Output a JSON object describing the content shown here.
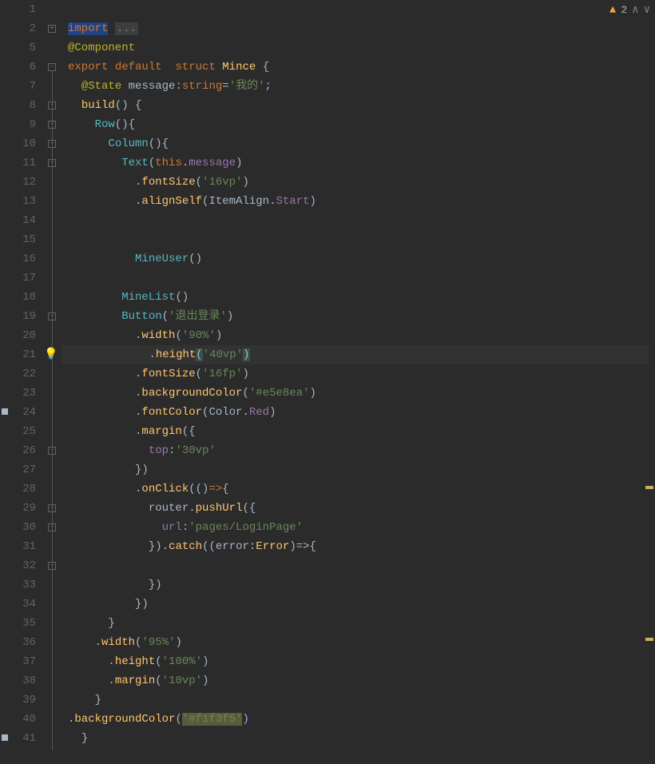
{
  "annotations": {
    "warn_count": "2"
  },
  "gutter_lines": [
    "1",
    "2",
    "5",
    "6",
    "7",
    "8",
    "9",
    "10",
    "11",
    "12",
    "13",
    "14",
    "15",
    "16",
    "17",
    "18",
    "19",
    "20",
    "21",
    "22",
    "23",
    "24",
    "25",
    "26",
    "27",
    "28",
    "29",
    "30",
    "31",
    "32",
    "33",
    "34",
    "35",
    "36",
    "37",
    "38",
    "39",
    "40",
    "41"
  ],
  "code": {
    "l1_import": "import",
    "l1_fold": "...",
    "l2_anno": "@Component",
    "l3_export": "export",
    "l3_default": "default",
    "l3_struct": "struct",
    "l3_name": "Mince",
    "l3_brace": " {",
    "l4_anno": "@State",
    "l4_var": " message",
    "l4_colon": ":",
    "l4_type": "string",
    "l4_eq": "=",
    "l4_str": "'我的'",
    "l4_semi": ";",
    "l5_build": "build",
    "l5_paren": "()",
    "l5_brace": " {",
    "l6_row": "Row",
    "l6_paren": "()",
    "l6_brace": "{",
    "l7_col": "Column",
    "l7_paren": "()",
    "l7_brace": "{",
    "l8_text": "Text",
    "l8_open": "(",
    "l8_this": "this",
    "l8_dot": ".",
    "l8_msg": "message",
    "l8_close": ")",
    "l9_dot": ".",
    "l9_fs": "fontSize",
    "l9_open": "(",
    "l9_str": "'16vp'",
    "l9_close": ")",
    "l10_dot": ".",
    "l10_as": "alignSelf",
    "l10_open": "(",
    "l10_ia": "ItemAlign",
    "l10_d2": ".",
    "l10_start": "Start",
    "l10_close": ")",
    "l13_mu": "MineUser",
    "l13_paren": "()",
    "l15_ml": "MineList",
    "l15_paren": "()",
    "l16_btn": "Button",
    "l16_open": "(",
    "l16_str": "'退出登录'",
    "l16_close": ")",
    "l17_dot": ".",
    "l17_w": "width",
    "l17_open": "(",
    "l17_str": "'90%'",
    "l17_close": ")",
    "l18_dot": ".",
    "l18_h": "height",
    "l18_open": "(",
    "l18_str": "'40vp'",
    "l18_close": ")",
    "l19_dot": ".",
    "l19_fs": "fontSize",
    "l19_open": "(",
    "l19_str": "'16fp'",
    "l19_close": ")",
    "l20_dot": ".",
    "l20_bg": "backgroundColor",
    "l20_open": "(",
    "l20_str": "'#e5e8ea'",
    "l20_close": ")",
    "l21_dot": ".",
    "l21_fc": "fontColor",
    "l21_open": "(",
    "l21_c": "Color",
    "l21_d2": ".",
    "l21_red": "Red",
    "l21_close": ")",
    "l22_dot": ".",
    "l22_m": "margin",
    "l22_open": "({",
    "l23_top": "top",
    "l23_colon": ":",
    "l23_str": "'30vp'",
    "l24_close": "})",
    "l25_dot": ".",
    "l25_oc": "onClick",
    "l25_open": "(()",
    "l25_arrow": "=>",
    "l25_brace": "{",
    "l26_r": "router",
    "l26_dot": ".",
    "l26_pu": "pushUrl",
    "l26_open": "({",
    "l27_url": "url",
    "l27_colon": ":",
    "l27_str": "'pages/LoginPage'",
    "l28_close1": "}).",
    "l28_catch": "catch",
    "l28_open": "((",
    "l28_err": "error",
    "l28_c2": ":",
    "l28_et": "Error",
    "l28_ar": ")=>",
    "l28_br": "{",
    "l30_close": "})",
    "l31_close": "})",
    "l32_brace": "}",
    "l33_dot": ".",
    "l33_w": "width",
    "l33_open": "(",
    "l33_str": "'95%'",
    "l33_close": ")",
    "l34_dot": ".",
    "l34_h": "height",
    "l34_open": "(",
    "l34_str": "'100%'",
    "l34_close": ")",
    "l35_dot": ".",
    "l35_m": "margin",
    "l35_open": "(",
    "l35_str": "'10vp'",
    "l35_close": ")",
    "l36_brace": "}",
    "l37_dot": ".",
    "l37_bg": "backgroundColor",
    "l37_open": "(",
    "l37_str": "'#f1f3f5'",
    "l37_close": ")",
    "l38_brace": "}"
  }
}
